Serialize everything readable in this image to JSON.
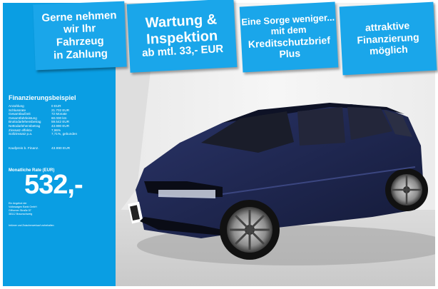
{
  "banners": [
    {
      "lines": [
        "Gerne nehmen",
        "wir Ihr",
        "Fahrzeug",
        "in Zahlung"
      ]
    },
    {
      "lines": [
        "Wartung &",
        "Inspektion",
        "ab mtl. 33,- EUR"
      ]
    },
    {
      "lines": [
        "Eine Sorge weniger...",
        "mit dem",
        "Kreditschutzbrief",
        "Plus"
      ]
    },
    {
      "lines": [
        "attraktive",
        "Finanzierung",
        "möglich"
      ]
    }
  ],
  "financing": {
    "title": "Finanzierungsbeispiel",
    "rows": [
      {
        "k": "Anzahlung",
        "v": "0 EUR"
      },
      {
        "k": "Schlussrate",
        "v": "21.702 EUR"
      },
      {
        "k": "Gesamtlaufzeit",
        "v": "72 Monate"
      },
      {
        "k": "Gesamtfahrleistung",
        "v": "60.000 km"
      },
      {
        "k": "Bruttodarlehensbetrag",
        "v": "59.542 EUR"
      },
      {
        "k": "Nettodarlehensbetrag",
        "v": "43.990 EUR"
      },
      {
        "k": "Zinssatz effektiv",
        "v": "7,96%"
      },
      {
        "k": "Sollzinssatz p.a.",
        "v": "7,71%, gebunden"
      }
    ],
    "kaufpreis_label": "Kaufpreis b. Finanz.",
    "kaufpreis_value": "43.990 EUR",
    "rate_label": "Monatliche Rate (EUR)",
    "rate_value": "532,-",
    "bank_lines": [
      "Ein Angebot der",
      "Volkswagen Bank GmbH",
      "Gifhorner Straße 57",
      "38112 Braunschweig"
    ],
    "note": "Irrtümer und Zwischenverkauf vorbehalten"
  },
  "colors": {
    "accent": "#1aa6ea",
    "panel": "#0a9ee3",
    "car": "#1c2348"
  }
}
